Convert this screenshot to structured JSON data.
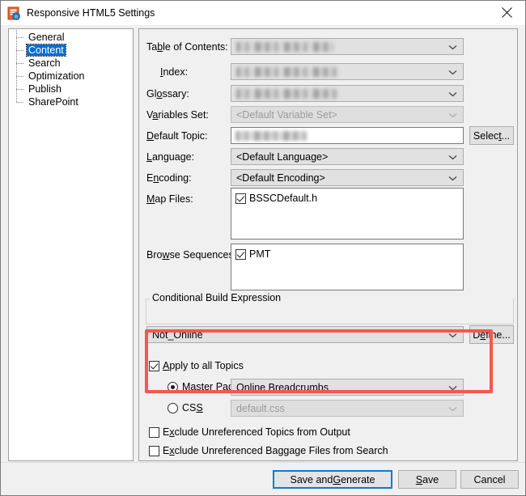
{
  "window": {
    "title": "Responsive HTML5 Settings",
    "icon": "responsive-html5-icon",
    "close_label": "×"
  },
  "sidebar": {
    "items": [
      {
        "label": "General",
        "selected": false
      },
      {
        "label": "Content",
        "selected": true
      },
      {
        "label": "Search",
        "selected": false
      },
      {
        "label": "Optimization",
        "selected": false
      },
      {
        "label": "Publish",
        "selected": false
      },
      {
        "label": "SharePoint",
        "selected": false
      }
    ]
  },
  "form": {
    "toc": {
      "label_a": "Ta",
      "label_u": "b",
      "label_b": "le of Contents:",
      "value": "",
      "redacted": true
    },
    "index": {
      "label_a": "",
      "label_u": "I",
      "label_b": "ndex:",
      "value": "",
      "redacted": true
    },
    "glossary": {
      "label_a": "Gl",
      "label_u": "o",
      "label_b": "ssary:",
      "value": "",
      "redacted": true
    },
    "variables_set": {
      "label_a": "V",
      "label_u": "a",
      "label_b": "riables Set:",
      "value": "<Default Variable Set>",
      "disabled": true
    },
    "default_topic": {
      "label_a": "",
      "label_u": "D",
      "label_b": "efault Topic:",
      "value": "",
      "redacted": true
    },
    "select_button": {
      "text_a": "Selec",
      "text_u": "t",
      "text_b": "..."
    },
    "language": {
      "label_a": "",
      "label_u": "L",
      "label_b": "anguage:",
      "value": "<Default Language>"
    },
    "encoding": {
      "label_a": "E",
      "label_u": "n",
      "label_b": "coding:",
      "value": "<Default Encoding>"
    },
    "map_files": {
      "label_a": "",
      "label_u": "M",
      "label_b": "ap Files:",
      "items": [
        {
          "label": "BSSCDefault.h",
          "checked": true
        }
      ]
    },
    "browse_sequences": {
      "label_a": "Bro",
      "label_u": "w",
      "label_b": "se Sequences:",
      "items": [
        {
          "label": "PMT",
          "checked": true
        }
      ]
    },
    "conditional_build": {
      "group_a": "",
      "group_u": "C",
      "group_b": "onditional Build Expression",
      "value": "Not_Online",
      "define_button": {
        "text_a": "D",
        "text_u": "e",
        "text_b": "fine..."
      }
    },
    "apply_all": {
      "label_a": "",
      "label_u": "A",
      "label_b": "pply to all Topics",
      "checked": true
    },
    "master_page": {
      "label_a": "Master ",
      "label_u": "P",
      "label_b": "age",
      "selected": true,
      "value": "Online Breadcrumbs"
    },
    "css": {
      "label_a": "CS",
      "label_u": "S",
      "label_b": "",
      "selected": false,
      "value": "default.css",
      "disabled": true
    },
    "exclude_topics": {
      "label_a": "E",
      "label_u": "x",
      "label_b": "clude Unreferenced Topics from Output",
      "checked": false
    },
    "exclude_baggage": {
      "label_a": "E",
      "label_u": "x",
      "label_b": "clude Unreferenced Baggage Files from Search",
      "checked": false
    }
  },
  "annotation": {
    "color": "#f8574f",
    "target": "apply-to-all-topics-group"
  },
  "footer": {
    "save_and_generate": {
      "text_a": "Save and ",
      "text_u": "G",
      "text_b": "enerate"
    },
    "save": {
      "text_a": "",
      "text_u": "S",
      "text_b": "ave"
    },
    "cancel": {
      "text_a": "Cancel",
      "text_u": "",
      "text_b": ""
    }
  }
}
